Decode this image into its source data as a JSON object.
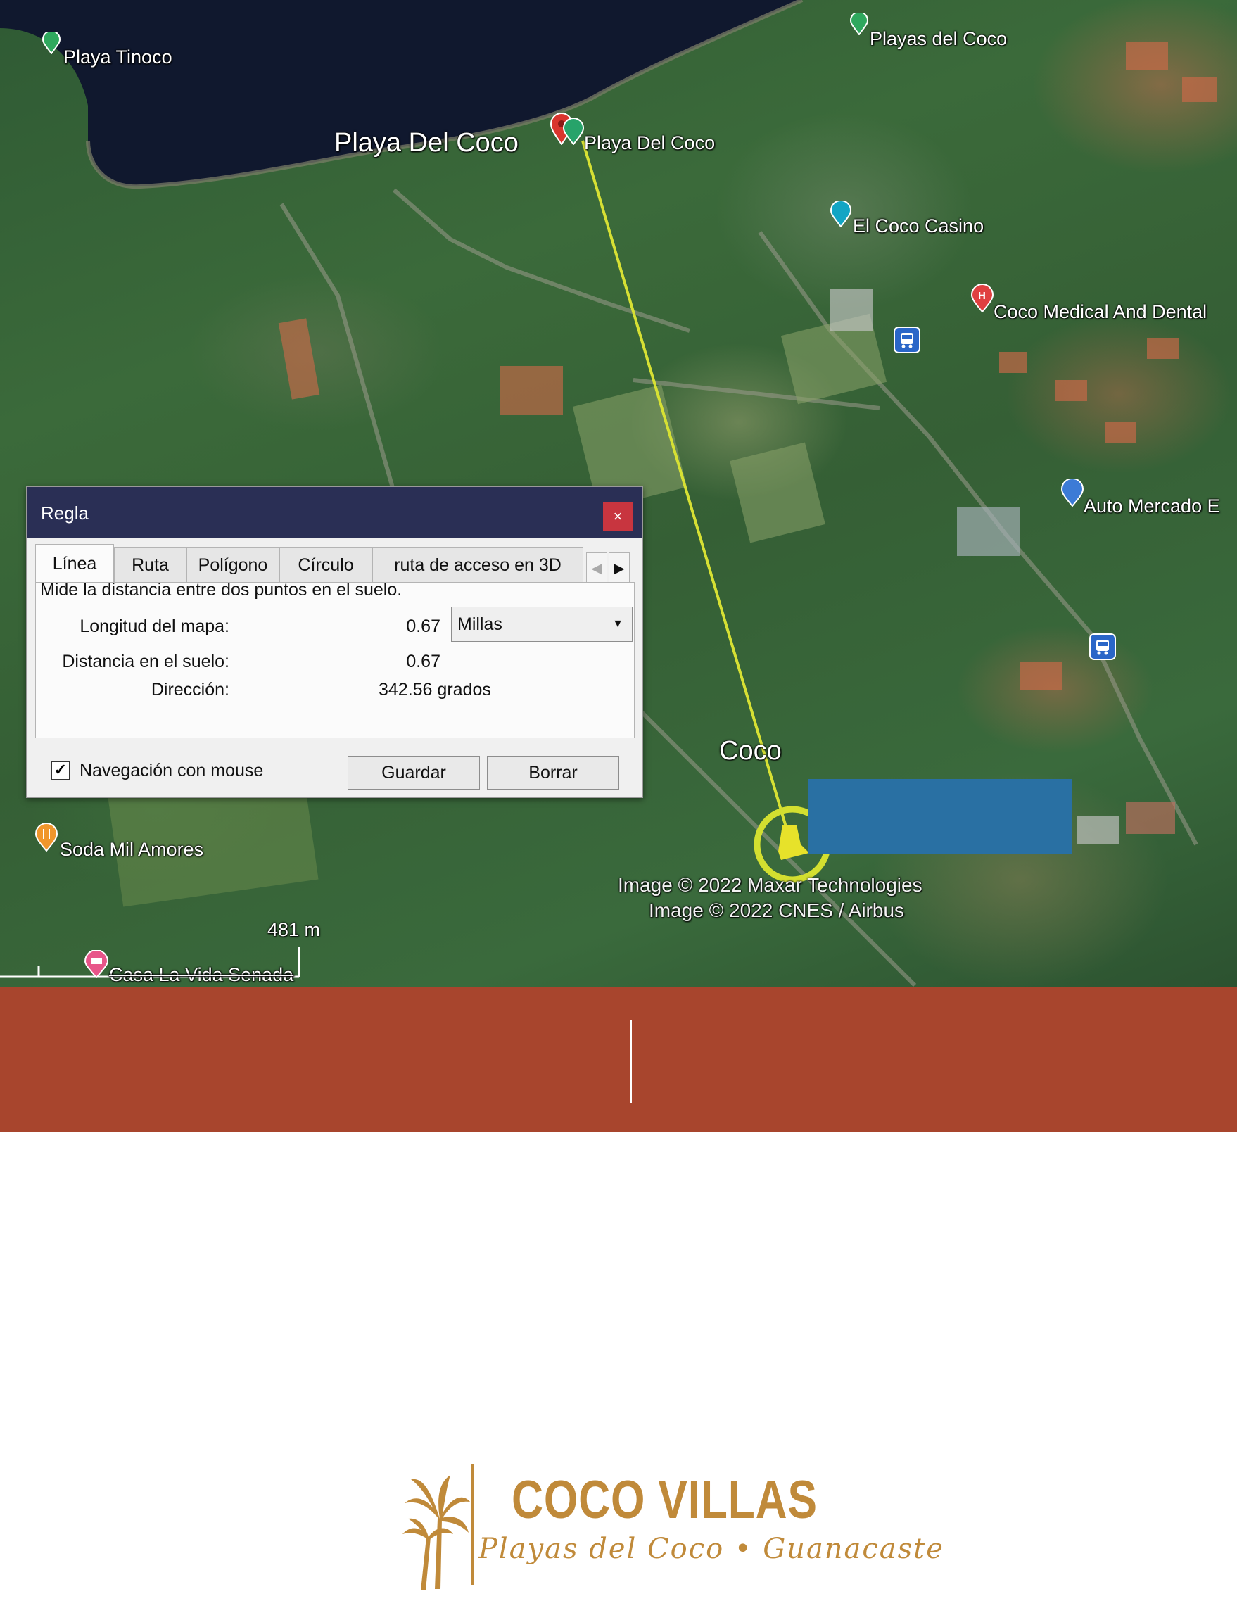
{
  "map": {
    "pois": [
      {
        "id": "playa-tinoco",
        "label": "Playa Tinoco"
      },
      {
        "id": "playas-del-coco",
        "label": "Playas del Coco"
      },
      {
        "id": "playa-del-coco-pin",
        "label": "Playa Del Coco"
      },
      {
        "id": "el-coco-casino",
        "label": "El Coco Casino"
      },
      {
        "id": "coco-medical",
        "label": "Coco Medical And Dental"
      },
      {
        "id": "auto-mercado",
        "label": "Auto Mercado E"
      },
      {
        "id": "soda-mil-amores",
        "label": "Soda Mil Amores"
      },
      {
        "id": "casa-la-vida",
        "label": "Casa La Vida Senada"
      }
    ],
    "area_labels": {
      "beach": "Playa Del Coco",
      "town": "Coco"
    },
    "scale_label": "481 m",
    "copyright": [
      "Image © 2022 Maxar Technologies",
      "Image © 2022 CNES / Airbus"
    ],
    "colors": {
      "ruler_line": "#d6e034",
      "pin_ring": "#d3df30",
      "water": "#10182e"
    }
  },
  "ruler": {
    "title": "Regla",
    "close_icon": "×",
    "tabs": [
      "Línea",
      "Ruta",
      "Polígono",
      "Círculo",
      "ruta de acceso en 3D"
    ],
    "active_tab": "Línea",
    "description": "Mide la distancia entre dos puntos en el suelo.",
    "map_length_label": "Longitud del mapa:",
    "map_length_value": "0.67",
    "unit": "Millas",
    "ground_distance_label": "Distancia en el suelo:",
    "ground_distance_value": "0.67",
    "direction_label": "Dirección:",
    "direction_value": "342.56 grados",
    "mouse_nav_label": "Navegación con mouse",
    "mouse_nav_checked": true,
    "save_label": "Guardar",
    "clear_label": "Borrar"
  },
  "brand": {
    "name": "COCO VILLAS",
    "tagline": "Playas del Coco • Guanacaste",
    "color": "#c08a3a"
  },
  "band_color": "#a8452d",
  "redaction_color": "#2970a3"
}
